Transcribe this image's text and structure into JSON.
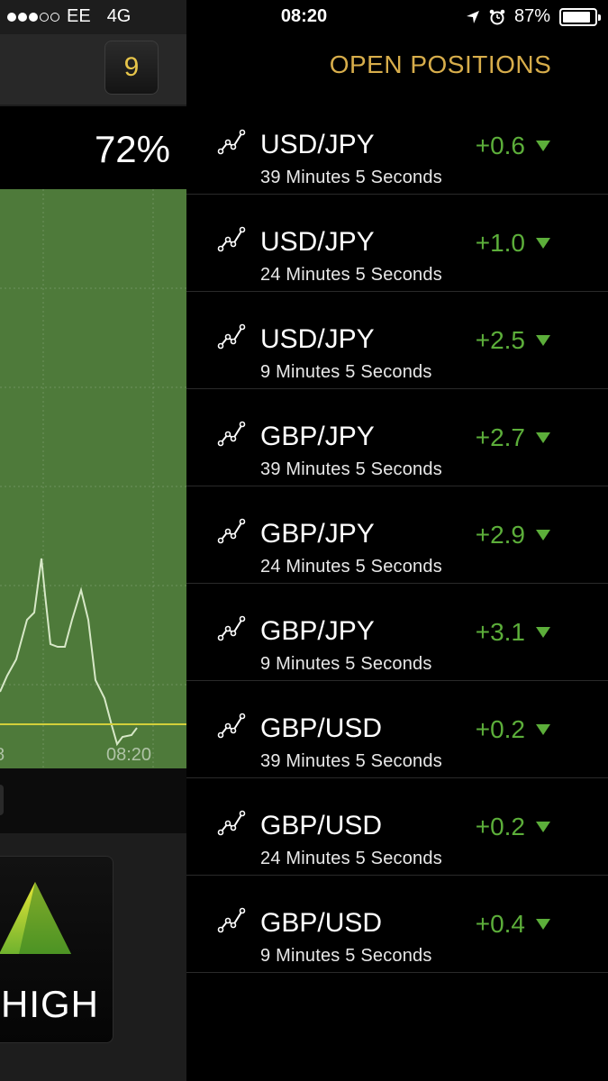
{
  "status_bar": {
    "carrier": "EE",
    "network": "4G",
    "time": "08:20",
    "battery": "87%",
    "battery_level": 0.87,
    "signal_bars_filled": 3,
    "signal_bars_total": 5
  },
  "trade_panel": {
    "count": "9",
    "payout": "72%",
    "chart_time_label": "08:20",
    "chart_time_label_cut": "8",
    "high_label": "HIGH"
  },
  "positions": {
    "title": "OPEN POSITIONS",
    "items": [
      {
        "pair": "USD/JPY",
        "duration": "39 Minutes 5 Seconds",
        "change": "+0.6"
      },
      {
        "pair": "USD/JPY",
        "duration": "24 Minutes 5 Seconds",
        "change": "+1.0"
      },
      {
        "pair": "USD/JPY",
        "duration": "9 Minutes 5 Seconds",
        "change": "+2.5"
      },
      {
        "pair": "GBP/JPY",
        "duration": "39 Minutes 5 Seconds",
        "change": "+2.7"
      },
      {
        "pair": "GBP/JPY",
        "duration": "24 Minutes 5 Seconds",
        "change": "+2.9"
      },
      {
        "pair": "GBP/JPY",
        "duration": "9 Minutes 5 Seconds",
        "change": "+3.1"
      },
      {
        "pair": "GBP/USD",
        "duration": "39 Minutes 5 Seconds",
        "change": "+0.2"
      },
      {
        "pair": "GBP/USD",
        "duration": "24 Minutes 5 Seconds",
        "change": "+0.2"
      },
      {
        "pair": "GBP/USD",
        "duration": "9 Minutes 5 Seconds",
        "change": "+0.4"
      }
    ]
  },
  "colors": {
    "accent_gold": "#d7ad4b",
    "positive_green": "#5cae3a",
    "chart_fill": "#4e7a3a"
  },
  "icons": {
    "position_row": "line-chart-icon",
    "trend_indicator": "triangle-down-icon",
    "high_button": "arrow-up-triangle-icon",
    "location": "location-arrow-icon",
    "alarm": "alarm-icon",
    "battery": "battery-icon"
  }
}
